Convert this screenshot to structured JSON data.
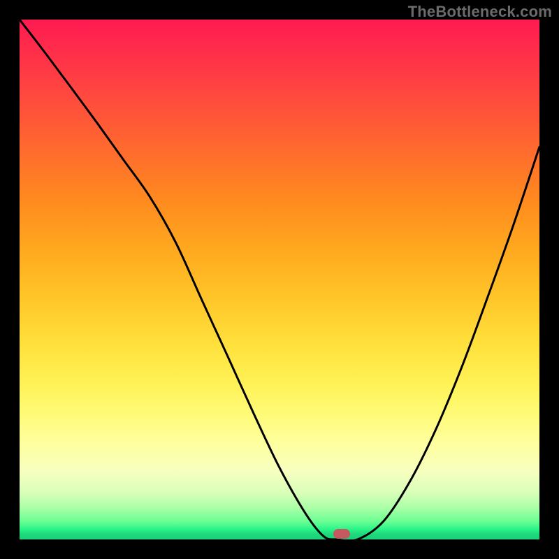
{
  "watermark": "TheBottleneck.com",
  "chart_data": {
    "type": "line",
    "title": "",
    "xlabel": "",
    "ylabel": "",
    "xlim": [
      0,
      1
    ],
    "ylim": [
      0,
      1
    ],
    "x": [
      0.0,
      0.05,
      0.1,
      0.15,
      0.2,
      0.25,
      0.3,
      0.35,
      0.4,
      0.45,
      0.5,
      0.55,
      0.585,
      0.61,
      0.65,
      0.7,
      0.75,
      0.8,
      0.85,
      0.9,
      0.95,
      1.0
    ],
    "values": [
      1.0,
      0.935,
      0.868,
      0.8,
      0.73,
      0.66,
      0.572,
      0.462,
      0.353,
      0.243,
      0.138,
      0.05,
      0.006,
      0.0,
      0.0,
      0.035,
      0.11,
      0.21,
      0.33,
      0.465,
      0.605,
      0.755
    ],
    "marker_x": 0.62,
    "marker_y": 0.0,
    "grid": false,
    "legend": false
  },
  "colors": {
    "curve": "#000000",
    "marker": "#c45a5f",
    "frame": "#000000"
  }
}
